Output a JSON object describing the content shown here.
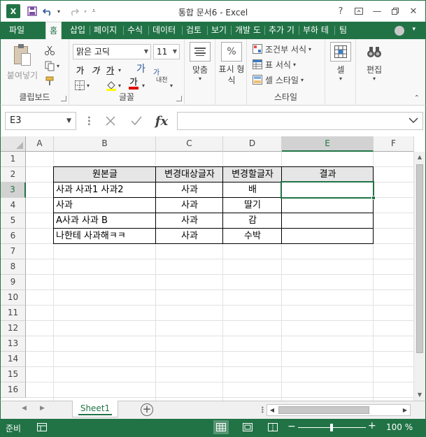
{
  "window": {
    "title": "통합 문서6 - Excel",
    "app_logo": "X",
    "help": "?",
    "colors": {
      "accent": "#217346",
      "selected_header": "#d2d2d2",
      "table_header_fill": "#e7e6e6"
    }
  },
  "ribbon": {
    "file_tab": "파일",
    "tabs": [
      "홈",
      "삽입",
      "페이지",
      "수식",
      "데이터",
      "검토",
      "보기",
      "개발 도",
      "추가 기",
      "부하 테",
      "팀"
    ],
    "clipboard": {
      "paste": "붙여넣기",
      "label": "클립보드"
    },
    "font": {
      "name": "맑은 고딕",
      "size": "11",
      "bold": "가",
      "italic": "가",
      "underline": "가",
      "grow": "가",
      "shrink": "가",
      "font_color": "가",
      "phonetic": "내천",
      "label": "글꼴"
    },
    "alignment": {
      "label": "맞춤"
    },
    "number": {
      "percent": "%",
      "label": "표시 형식"
    },
    "styles": {
      "conditional": "조건부 서식",
      "table": "표 서식",
      "cell_styles": "셀 스타일",
      "label": "스타일"
    },
    "cells": {
      "label": "셀"
    },
    "editing": {
      "label": "편집"
    }
  },
  "formula_bar": {
    "name_box": "E3",
    "fx": "fx",
    "formula": ""
  },
  "sheet": {
    "columns": [
      "A",
      "B",
      "C",
      "D",
      "E",
      "F"
    ],
    "rows": [
      "1",
      "2",
      "3",
      "4",
      "5",
      "6",
      "7",
      "8",
      "9",
      "10",
      "11",
      "12",
      "13",
      "14",
      "15",
      "16"
    ],
    "selected_column": "E",
    "selected_row": "3",
    "table": {
      "headers": [
        "원본글",
        "변경대상글자",
        "변경할글자",
        "결과"
      ],
      "rows": [
        [
          "사과 사과1 사과2",
          "사과",
          "배",
          ""
        ],
        [
          "사과",
          "사과",
          "딸기",
          ""
        ],
        [
          "A사과  사과 B",
          "사과",
          "감",
          ""
        ],
        [
          "나한테 사과해ㅋㅋ",
          "사과",
          "수박",
          ""
        ]
      ]
    }
  },
  "sheet_tabs": {
    "active": "Sheet1",
    "add": "+"
  },
  "status": {
    "text": "준비",
    "zoom": "100 %",
    "zoom_minus": "−",
    "zoom_plus": "+"
  }
}
